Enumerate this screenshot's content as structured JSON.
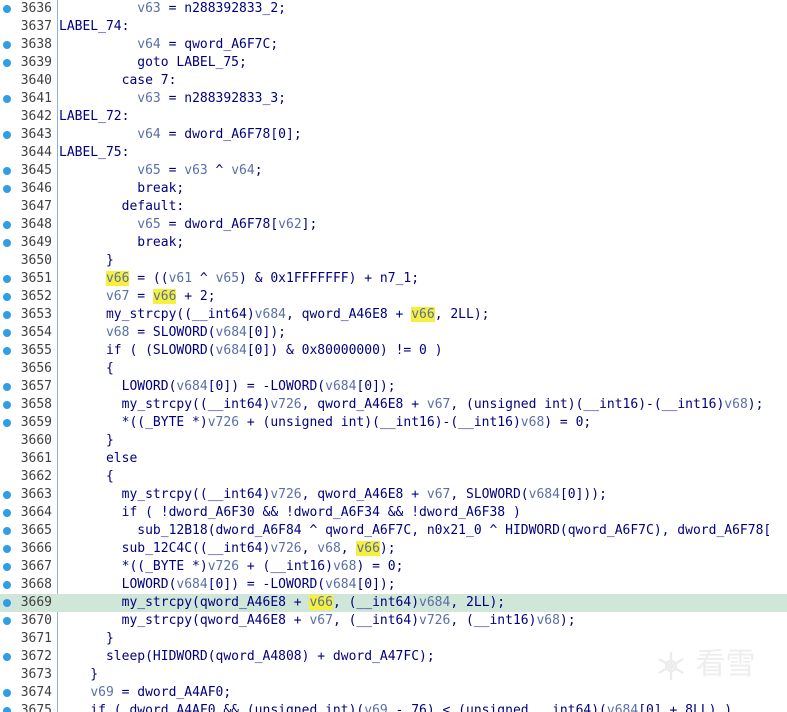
{
  "highlight_var": "v66",
  "current_line": "3669",
  "watermark": {
    "icon": "snowflake-icon",
    "text": "看雪"
  },
  "lines": [
    {
      "n": "3636",
      "bp": true,
      "code": "          v63 = n288392833_2;"
    },
    {
      "n": "3637",
      "bp": false,
      "code": "LABEL_74:"
    },
    {
      "n": "3638",
      "bp": true,
      "code": "          v64 = qword_A6F7C;"
    },
    {
      "n": "3639",
      "bp": true,
      "code": "          goto LABEL_75;"
    },
    {
      "n": "3640",
      "bp": false,
      "code": "        case 7:"
    },
    {
      "n": "3641",
      "bp": true,
      "code": "          v63 = n288392833_3;"
    },
    {
      "n": "3642",
      "bp": false,
      "code": "LABEL_72:"
    },
    {
      "n": "3643",
      "bp": true,
      "code": "          v64 = dword_A6F78[0];"
    },
    {
      "n": "3644",
      "bp": false,
      "code": "LABEL_75:"
    },
    {
      "n": "3645",
      "bp": true,
      "code": "          v65 = v63 ^ v64;"
    },
    {
      "n": "3646",
      "bp": true,
      "code": "          break;"
    },
    {
      "n": "3647",
      "bp": false,
      "code": "        default:"
    },
    {
      "n": "3648",
      "bp": true,
      "code": "          v65 = dword_A6F78[v62];"
    },
    {
      "n": "3649",
      "bp": true,
      "code": "          break;"
    },
    {
      "n": "3650",
      "bp": false,
      "code": "      }"
    },
    {
      "n": "3651",
      "bp": true,
      "code": "      v66 = ((v61 ^ v65) & 0x1FFFFFFF) + n7_1;"
    },
    {
      "n": "3652",
      "bp": true,
      "code": "      v67 = v66 + 2;"
    },
    {
      "n": "3653",
      "bp": true,
      "code": "      my_strcpy((__int64)v684, qword_A46E8 + v66, 2LL);"
    },
    {
      "n": "3654",
      "bp": true,
      "code": "      v68 = SLOWORD(v684[0]);"
    },
    {
      "n": "3655",
      "bp": true,
      "code": "      if ( (SLOWORD(v684[0]) & 0x80000000) != 0 )"
    },
    {
      "n": "3656",
      "bp": false,
      "code": "      {"
    },
    {
      "n": "3657",
      "bp": true,
      "code": "        LOWORD(v684[0]) = -LOWORD(v684[0]);"
    },
    {
      "n": "3658",
      "bp": true,
      "code": "        my_strcpy((__int64)v726, qword_A46E8 + v67, (unsigned int)(__int16)-(__int16)v68);"
    },
    {
      "n": "3659",
      "bp": true,
      "code": "        *((_BYTE *)v726 + (unsigned int)(__int16)-(__int16)v68) = 0;"
    },
    {
      "n": "3660",
      "bp": false,
      "code": "      }"
    },
    {
      "n": "3661",
      "bp": false,
      "code": "      else"
    },
    {
      "n": "3662",
      "bp": false,
      "code": "      {"
    },
    {
      "n": "3663",
      "bp": true,
      "code": "        my_strcpy((__int64)v726, qword_A46E8 + v67, SLOWORD(v684[0]));"
    },
    {
      "n": "3664",
      "bp": true,
      "code": "        if ( !dword_A6F30 && !dword_A6F34 && !dword_A6F38 )"
    },
    {
      "n": "3665",
      "bp": true,
      "code": "          sub_12B18(dword_A6F84 ^ qword_A6F7C, n0x21_0 ^ HIDWORD(qword_A6F7C), dword_A6F78["
    },
    {
      "n": "3666",
      "bp": true,
      "code": "        sub_12C4C((__int64)v726, v68, v66);"
    },
    {
      "n": "3667",
      "bp": true,
      "code": "        *((_BYTE *)v726 + (__int16)v68) = 0;"
    },
    {
      "n": "3668",
      "bp": true,
      "code": "        LOWORD(v684[0]) = -LOWORD(v684[0]);"
    },
    {
      "n": "3669",
      "bp": true,
      "code": "        my_strcpy(qword_A46E8 + v66, (__int64)v684, 2LL);"
    },
    {
      "n": "3670",
      "bp": true,
      "code": "        my_strcpy(qword_A46E8 + v67, (__int64)v726, (__int16)v68);"
    },
    {
      "n": "3671",
      "bp": false,
      "code": "      }"
    },
    {
      "n": "3672",
      "bp": true,
      "code": "      sleep(HIDWORD(qword_A4808) + dword_A47FC);"
    },
    {
      "n": "3673",
      "bp": false,
      "code": "    }"
    },
    {
      "n": "3674",
      "bp": true,
      "code": "    v69 = dword_A4AF0;"
    },
    {
      "n": "3675",
      "bp": true,
      "code": "    if ( dword_A4AF0 && (unsigned int)(v69 - 76) < (unsigned __int64)(v684[0] + 8LL) )"
    }
  ]
}
